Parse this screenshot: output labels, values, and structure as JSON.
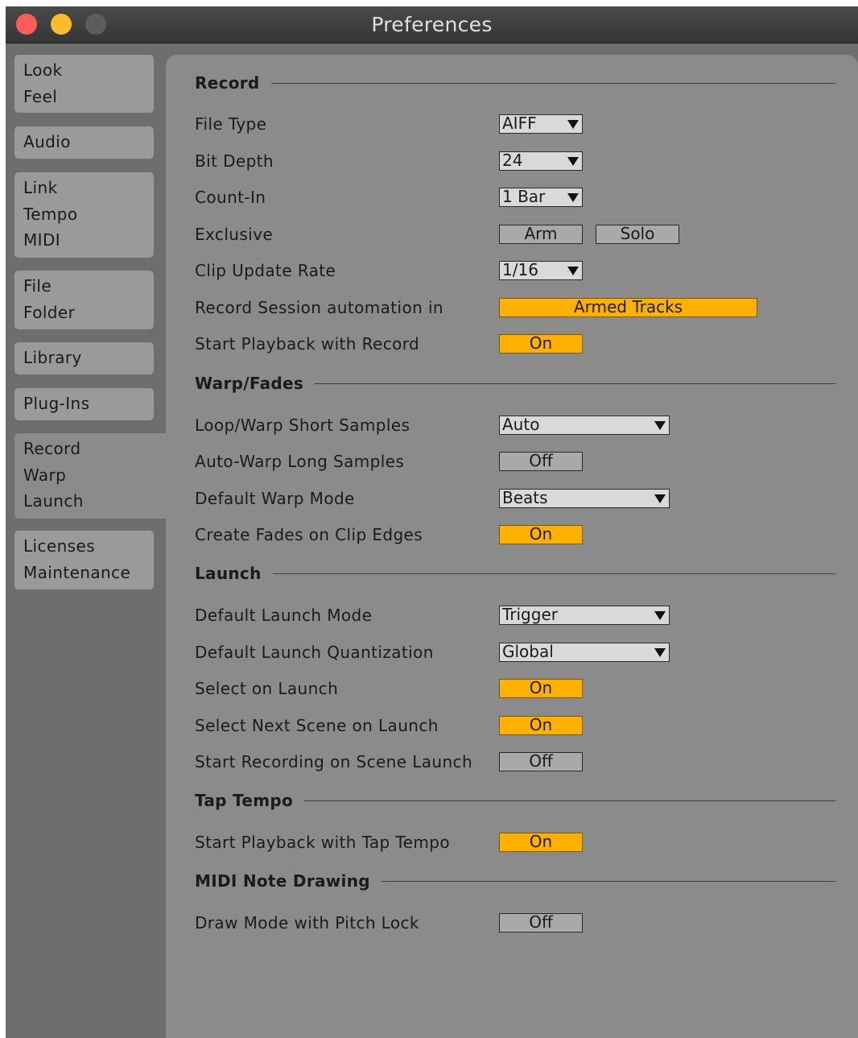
{
  "window": {
    "title": "Preferences"
  },
  "sidebar": {
    "groups": [
      [
        "Look",
        "Feel"
      ],
      [
        "Audio"
      ],
      [
        "Link",
        "Tempo",
        "MIDI"
      ],
      [
        "File",
        "Folder"
      ],
      [
        "Library"
      ],
      [
        "Plug-Ins"
      ],
      [
        "Record",
        "Warp",
        "Launch"
      ],
      [
        "Licenses",
        "Maintenance"
      ]
    ],
    "active_group": 6
  },
  "sections": {
    "record": {
      "title": "Record",
      "file_type": {
        "label": "File Type",
        "value": "AIFF"
      },
      "bit_depth": {
        "label": "Bit Depth",
        "value": "24"
      },
      "count_in": {
        "label": "Count-In",
        "value": "1 Bar"
      },
      "exclusive": {
        "label": "Exclusive",
        "arm": "Arm",
        "solo": "Solo"
      },
      "clip_update_rate": {
        "label": "Clip Update Rate",
        "value": "1/16"
      },
      "session_automation": {
        "label": "Record Session automation in",
        "value": "Armed Tracks"
      },
      "start_playback": {
        "label": "Start Playback with Record",
        "value": "On"
      }
    },
    "warp": {
      "title": "Warp/Fades",
      "loop_warp_short": {
        "label": "Loop/Warp Short Samples",
        "value": "Auto"
      },
      "auto_warp_long": {
        "label": "Auto-Warp Long Samples",
        "value": "Off"
      },
      "default_warp_mode": {
        "label": "Default Warp Mode",
        "value": "Beats"
      },
      "create_fades": {
        "label": "Create Fades on Clip Edges",
        "value": "On"
      }
    },
    "launch": {
      "title": "Launch",
      "default_launch_mode": {
        "label": "Default Launch Mode",
        "value": "Trigger"
      },
      "default_launch_quant": {
        "label": "Default Launch Quantization",
        "value": "Global"
      },
      "select_on_launch": {
        "label": "Select on Launch",
        "value": "On"
      },
      "select_next_scene": {
        "label": "Select Next Scene on Launch",
        "value": "On"
      },
      "start_recording_scene": {
        "label": "Start Recording on Scene Launch",
        "value": "Off"
      }
    },
    "tap_tempo": {
      "title": "Tap Tempo",
      "start_playback_tap": {
        "label": "Start Playback with Tap Tempo",
        "value": "On"
      }
    },
    "midi_note": {
      "title": "MIDI Note Drawing",
      "draw_mode_pitch_lock": {
        "label": "Draw Mode with Pitch Lock",
        "value": "Off"
      }
    }
  },
  "colors": {
    "accent_on": "#ffb000",
    "panel": "#8b8b8b",
    "toggle_off": "#a9a9a9"
  }
}
